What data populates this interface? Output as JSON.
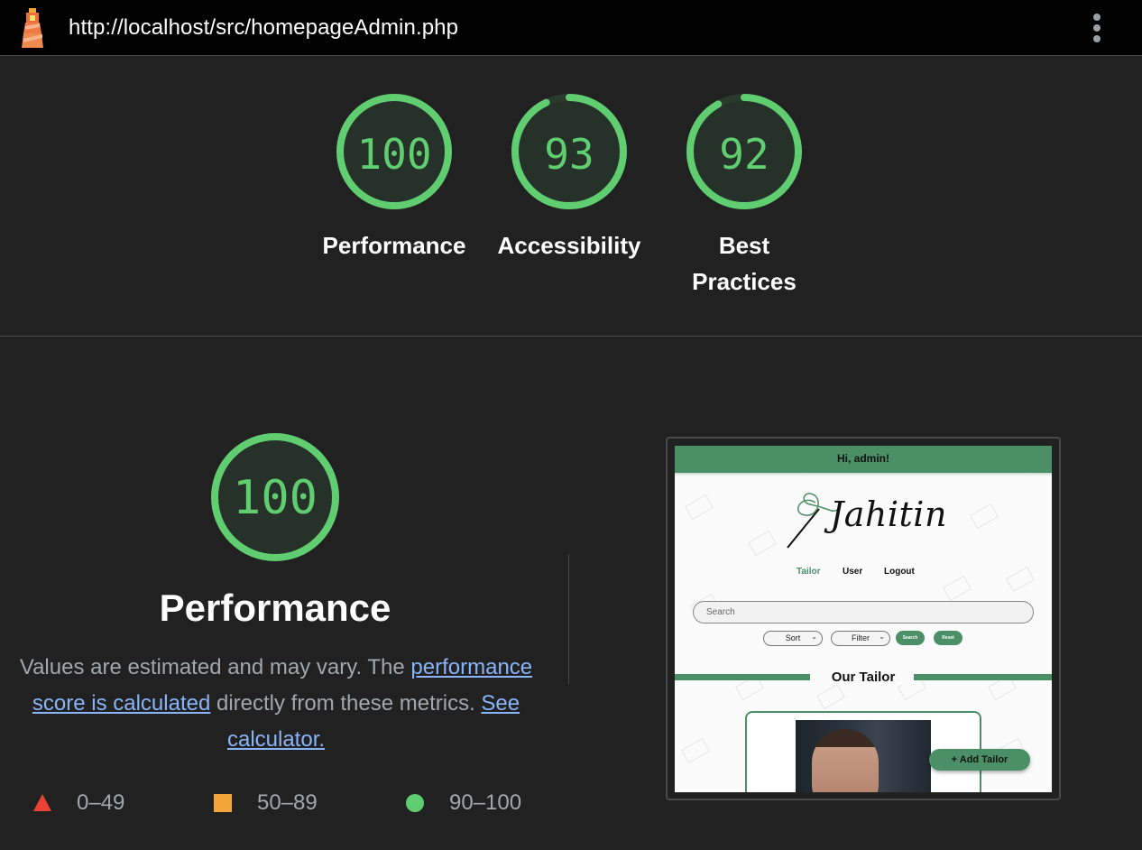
{
  "header": {
    "url": "http://localhost/src/homepageAdmin.php",
    "logo_icon": "lighthouse-icon",
    "menu_icon": "kebab-menu-icon"
  },
  "scores": [
    {
      "value": "100",
      "label": "Performance",
      "fraction": 1.0
    },
    {
      "value": "93",
      "label": "Accessibility",
      "fraction": 0.93
    },
    {
      "value": "92",
      "label": "Best Practices",
      "label_lines": [
        "Best",
        "Practices"
      ],
      "fraction": 0.92
    }
  ],
  "performance": {
    "score": "100",
    "fraction": 1.0,
    "title": "Performance",
    "desc_prefix": "Values are estimated and may vary. The ",
    "desc_link1": "performance score is calculated",
    "desc_middle": " directly from these metrics. ",
    "desc_link2": "See calculator."
  },
  "legend": [
    {
      "shape": "triangle",
      "color": "#ea4335",
      "range": "0–49"
    },
    {
      "shape": "square",
      "color": "#f4a53a",
      "range": "50–89"
    },
    {
      "shape": "circle",
      "color": "#5fcd70",
      "range": "90–100"
    }
  ],
  "colors": {
    "pass": "#5fcd70",
    "gauge_bg": "#2a3a2e",
    "link": "#8ab4f8",
    "background": "#212121"
  },
  "screenshot": {
    "greeting": "Hi, admin!",
    "logo_text": "Jahitin",
    "nav": [
      "Tailor",
      "User",
      "Logout"
    ],
    "search_placeholder": "Search",
    "sort_label": "Sort",
    "filter_label": "Filter",
    "search_button": "Search",
    "reset_button": "Reset",
    "section_title": "Our Tailor",
    "add_button": "+ Add Tailor",
    "accent": "#4a8f66"
  }
}
